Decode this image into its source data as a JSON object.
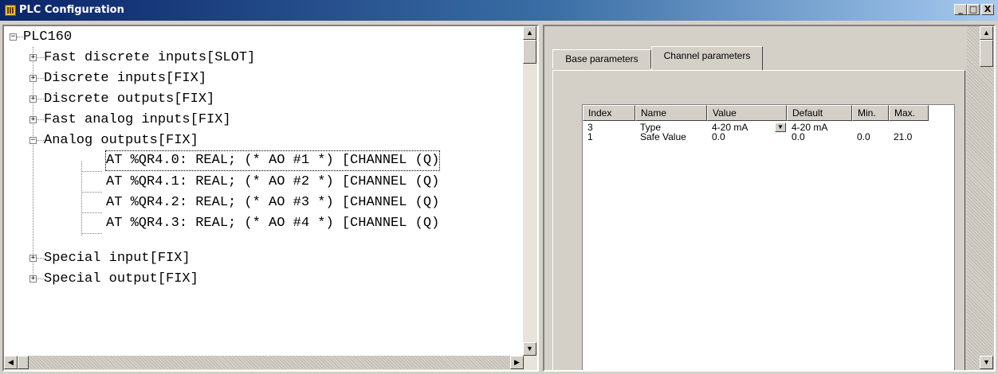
{
  "window": {
    "title": "PLC Configuration",
    "controls": {
      "minimize": "_",
      "maximize": "□",
      "close": "X"
    }
  },
  "tree": {
    "root": "PLC160",
    "items": [
      {
        "label": "Fast discrete inputs[SLOT]",
        "expander": "+"
      },
      {
        "label": "Discrete inputs[FIX]",
        "expander": "+"
      },
      {
        "label": "Discrete outputs[FIX]",
        "expander": "+"
      },
      {
        "label": "Fast analog inputs[FIX]",
        "expander": "+"
      },
      {
        "label": "Analog outputs[FIX]",
        "expander": "−"
      },
      {
        "label": "AT %QR4.0: REAL; (* AO #1 *) [CHANNEL (Q)"
      },
      {
        "label": "AT %QR4.1: REAL; (* AO #2 *) [CHANNEL (Q)"
      },
      {
        "label": "AT %QR4.2: REAL; (* AO #3 *) [CHANNEL (Q)"
      },
      {
        "label": "AT %QR4.3: REAL; (* AO #4 *) [CHANNEL (Q)"
      },
      {
        "label": "Special input[FIX]",
        "expander": "+"
      },
      {
        "label": "Special output[FIX]",
        "expander": "+"
      }
    ]
  },
  "tabs": [
    {
      "label": "Base parameters"
    },
    {
      "label": "Channel parameters"
    }
  ],
  "grid": {
    "headers": [
      "Index",
      "Name",
      "Value",
      "Default",
      "Min.",
      "Max."
    ],
    "rows": [
      {
        "index": "3",
        "name": "Type",
        "value": "4-20 mA",
        "default": "4-20 mA",
        "min": "",
        "max": ""
      },
      {
        "index": "1",
        "name": "Safe Value",
        "value": "0.0",
        "default": "0.0",
        "min": "0.0",
        "max": "21.0"
      }
    ]
  },
  "icons": {
    "arrow_up": "▲",
    "arrow_down": "▼",
    "arrow_left": "◀",
    "arrow_right": "▶",
    "dropdown": "▼"
  },
  "colors": {
    "titlebar_start": "#0a246a",
    "titlebar_end": "#a6caf0",
    "face": "#d4d0c8"
  }
}
